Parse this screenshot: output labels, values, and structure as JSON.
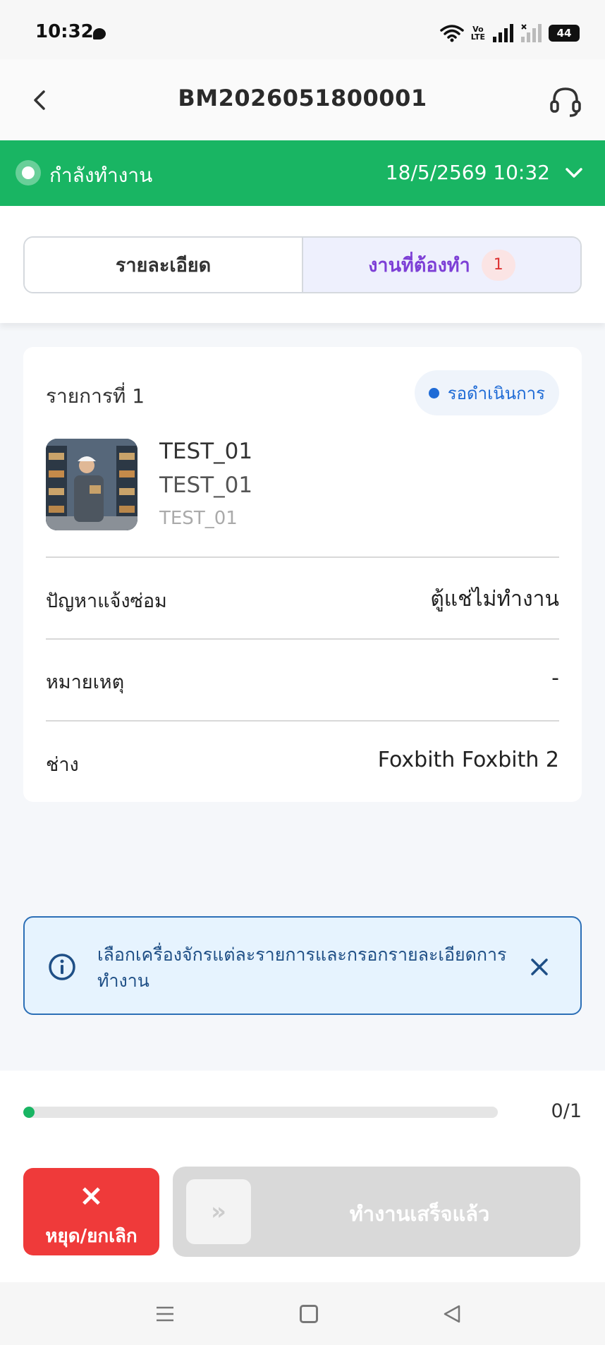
{
  "status_bar": {
    "time": "10:32",
    "volte_top": "Vo",
    "volte_bottom": "LTE",
    "battery": "44"
  },
  "header": {
    "title": "BM2026051800001",
    "back_icon": "chevron-left-icon",
    "support_icon": "headset-icon"
  },
  "status_band": {
    "label": "กำลังทำงาน",
    "datetime": "18/5/2569 10:32",
    "color": "#19b563"
  },
  "tabs": [
    {
      "label": "รายละเอียด",
      "active": false
    },
    {
      "label": "งานที่ต้องทำ",
      "badge": "1",
      "active": true
    }
  ],
  "card": {
    "item_no": "รายการที่ 1",
    "status_badge": "รอดำเนินการ",
    "machine": {
      "line1": "TEST_01",
      "line2": "TEST_01",
      "line3": "TEST_01"
    },
    "rows": [
      {
        "label": "ปัญหาแจ้งซ่อม",
        "value": "ตู้แช่ไม่ทำงาน"
      },
      {
        "label": "หมายเหตุ",
        "value": "-"
      },
      {
        "label": "ช่าง",
        "value": "Foxbith Foxbith 2"
      }
    ]
  },
  "info": {
    "text": "เลือกเครื่องจักรแต่ละรายการและกรอกรายละเอียดการทำงาน"
  },
  "progress": {
    "fraction": 0,
    "count": "0/1"
  },
  "actions": {
    "stop_label": "หยุด/ยกเลิก",
    "stop_icon": "×",
    "finish_label": "ทำงานเสร็จแล้ว",
    "handle_icon": "»"
  },
  "colors": {
    "accent_green": "#19b563",
    "danger_red": "#ef3a3a",
    "tab_active_text": "#7d3fd6",
    "info_blue": "#2c6fb6"
  }
}
